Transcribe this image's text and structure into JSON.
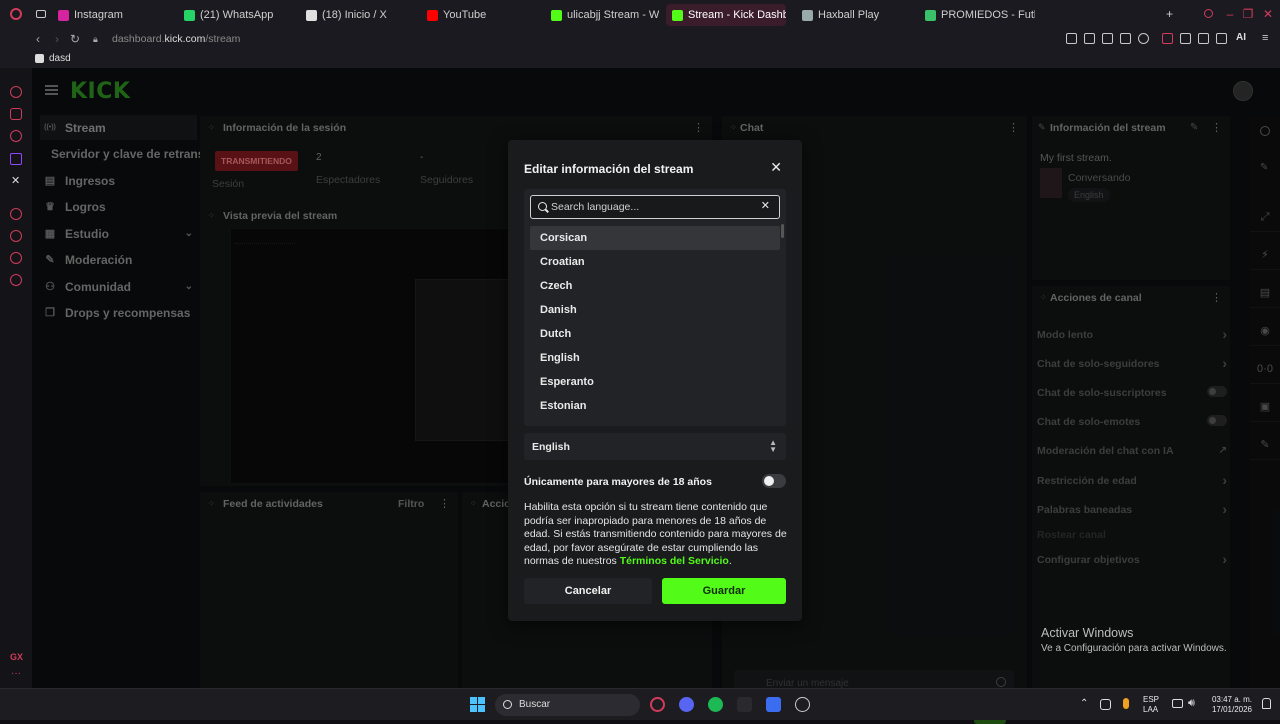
{
  "browser": {
    "tabs": [
      {
        "label": "Instagram",
        "color": "#d6249f"
      },
      {
        "label": "(21) WhatsApp",
        "color": "#25d366"
      },
      {
        "label": "(18) Inicio / X",
        "color": "#e0e0e0"
      },
      {
        "label": "YouTube",
        "color": "#ff0000"
      },
      {
        "label": "ulicabjj Stream - Watch L",
        "color": "#53fc18"
      },
      {
        "label": "Stream - Kick Dashboa",
        "color": "#53fc18",
        "active": true
      },
      {
        "label": "Haxball Play",
        "color": "#9aa"
      },
      {
        "label": "PROMIEDOS - Futbol Arg",
        "color": "#3ac26b"
      }
    ],
    "url_prefix": "dashboard.",
    "url_domain": "kick.com",
    "url_path": "/stream",
    "bookmark": "dasd",
    "ai_label": "AI"
  },
  "header": {
    "logo": "KICK"
  },
  "sidenav": {
    "items": [
      {
        "label": "Stream",
        "icon": "broadcast-icon"
      },
      {
        "label": "Servidor y clave de retransm",
        "icon": ""
      },
      {
        "label": "Ingresos",
        "icon": "chart-icon"
      },
      {
        "label": "Logros",
        "icon": "trophy-icon"
      },
      {
        "label": "Estudio",
        "icon": "grid-icon"
      },
      {
        "label": "Moderación",
        "icon": "wrench-icon"
      },
      {
        "label": "Comunidad",
        "icon": "people-icon"
      },
      {
        "label": "Drops y recompensas",
        "icon": "gift-icon"
      }
    ]
  },
  "panels": {
    "session": {
      "title": "Información de la sesión",
      "live_badge": "TRANSMITIENDO",
      "session_label": "Sesión",
      "viewers_value": "2",
      "viewers_label": "Espectadores",
      "followers_value": "-",
      "followers_label": "Seguidores"
    },
    "preview": {
      "title": "Vista previa del stream"
    },
    "activity": {
      "title": "Feed de actividades",
      "filter": "Filtro"
    },
    "actions_small": {
      "title": "Accio"
    },
    "chat": {
      "title": "Chat",
      "input_placeholder": "Enviar un mensaje",
      "send_label": "Chat"
    },
    "stream_info": {
      "title": "Información del stream",
      "stream_title": "My first stream.",
      "category": "Conversando",
      "language_tag": "English"
    },
    "channel_actions": {
      "title": "Acciones de canal",
      "rows": [
        {
          "label": "Modo lento",
          "control": "chevron"
        },
        {
          "label": "Chat de solo-seguidores",
          "control": "chevron"
        },
        {
          "label": "Chat de solo-suscriptores",
          "control": "toggle"
        },
        {
          "label": "Chat de solo-emotes",
          "control": "toggle"
        },
        {
          "label": "Moderación del chat con IA",
          "control": "external"
        },
        {
          "label": "Restricción de edad",
          "control": "chevron"
        },
        {
          "label": "Palabras baneadas",
          "control": "chevron"
        },
        {
          "label": "Rostear canal",
          "control": "none"
        },
        {
          "label": "Configurar objetivos",
          "control": "chevron"
        }
      ]
    }
  },
  "modal": {
    "title": "Editar información del stream",
    "search_placeholder": "Search language...",
    "languages": [
      "Corsican",
      "Croatian",
      "Czech",
      "Danish",
      "Dutch",
      "English",
      "Esperanto",
      "Estonian"
    ],
    "highlighted_language": "Corsican",
    "selected_language": "English",
    "adult_label": "Únicamente para mayores de 18 años",
    "adult_enabled": false,
    "adult_description": "Habilita esta opción si tu stream tiene contenido que podría ser inapropiado para menores de 18 años de edad. Si estás transmitiendo contenido para mayores de edad, por favor asegúrate de estar cumpliendo las normas de nuestros ",
    "terms_link": "Términos del Servicio",
    "terms_suffix": ".",
    "cancel_label": "Cancelar",
    "save_label": "Guardar",
    "accent_color": "#53fc18"
  },
  "watermark": {
    "line1": "Activar Windows",
    "line2": "Ve a Configuración para activar Windows."
  },
  "taskbar": {
    "search_label": "Buscar",
    "lang_line1": "ESP",
    "lang_line2": "LAA",
    "time": "03:47 a. m.",
    "date": "17/01/2026"
  }
}
